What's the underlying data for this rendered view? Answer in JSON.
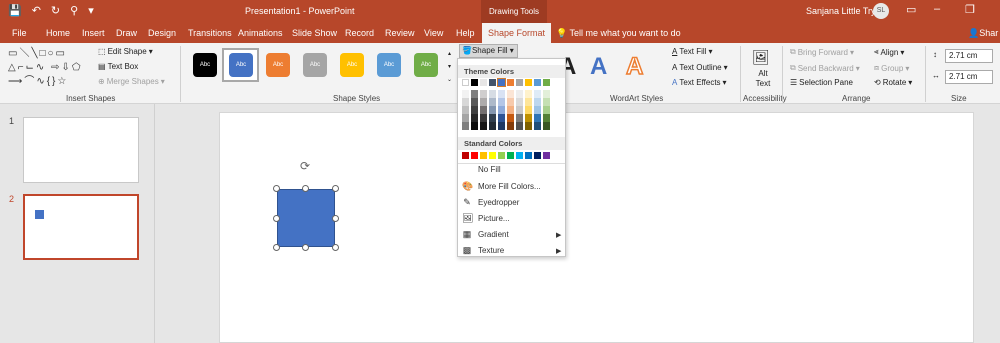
{
  "titlebar": {
    "qat": [
      "💾",
      "↶",
      "↻",
      "⚲",
      "▾"
    ],
    "title": "Presentation1 - PowerPoint",
    "contextual": "Drawing Tools",
    "user": "Sanjana Little Try",
    "avatar": "SL",
    "share": "Shar"
  },
  "tabs": [
    "File",
    "Home",
    "Insert",
    "Draw",
    "Design",
    "Transitions",
    "Animations",
    "Slide Show",
    "Record",
    "Review",
    "View",
    "Help",
    "Shape Format"
  ],
  "tellme": "Tell me what you want to do",
  "ribbon": {
    "insert_shapes": {
      "label": "Insert Shapes",
      "edit_shape": "Edit Shape",
      "text_box": "Text Box",
      "merge_shapes": "Merge Shapes"
    },
    "shape_styles": {
      "label": "Shape Styles",
      "sample": "Abc",
      "colors": [
        "#000000",
        "#4472c4",
        "#ed7d31",
        "#a5a5a5",
        "#ffc000",
        "#5b9bd5",
        "#70ad47"
      ]
    },
    "shape_fill": "Shape Fill",
    "wordart": {
      "label": "WordArt Styles",
      "text_fill": "Text Fill",
      "text_outline": "Text Outline",
      "text_effects": "Text Effects"
    },
    "accessibility": {
      "label": "Accessibility",
      "alt_text": "Alt Text"
    },
    "arrange": {
      "label": "Arrange",
      "bring_forward": "Bring Forward",
      "send_backward": "Send Backward",
      "selection_pane": "Selection Pane",
      "align": "Align",
      "group": "Group",
      "rotate": "Rotate"
    },
    "size": {
      "label": "Size",
      "height": "2.71 cm",
      "width": "2.71 cm"
    }
  },
  "slides": [
    "1",
    "2"
  ],
  "dropdown": {
    "theme_colors_label": "Theme Colors",
    "theme_top_row": [
      "#ffffff",
      "#000000",
      "#e7e6e6",
      "#44546a",
      "#4472c4",
      "#ed7d31",
      "#a5a5a5",
      "#ffc000",
      "#5b9bd5",
      "#70ad47"
    ],
    "theme_shades": [
      [
        "#f2f2f2",
        "#7f7f7f",
        "#d0cece",
        "#d6dce4",
        "#d9e2f3",
        "#fbe5d5",
        "#ededed",
        "#fff2cc",
        "#deebf6",
        "#e2efd9"
      ],
      [
        "#d8d8d8",
        "#595959",
        "#aeabab",
        "#adb9ca",
        "#b4c6e7",
        "#f7caac",
        "#dbdbdb",
        "#fee599",
        "#bdd7ee",
        "#c5e0b3"
      ],
      [
        "#bfbfbf",
        "#3f3f3f",
        "#757070",
        "#8496b0",
        "#8eaadb",
        "#f4b183",
        "#c9c9c9",
        "#ffd965",
        "#9cc3e5",
        "#a8d08d"
      ],
      [
        "#a5a5a5",
        "#262626",
        "#3a3838",
        "#323f4f",
        "#2f5496",
        "#c55a11",
        "#7b7b7b",
        "#bf9000",
        "#2e75b5",
        "#538135"
      ],
      [
        "#7f7f7f",
        "#0c0c0c",
        "#171616",
        "#222a35",
        "#1f3864",
        "#833c0b",
        "#525252",
        "#7f6000",
        "#1e4e79",
        "#375623"
      ]
    ],
    "standard_colors_label": "Standard Colors",
    "standard_colors": [
      "#c00000",
      "#ff0000",
      "#ffc000",
      "#ffff00",
      "#92d050",
      "#00b050",
      "#00b0f0",
      "#0070c0",
      "#002060",
      "#7030a0"
    ],
    "items": [
      "No Fill",
      "More Fill Colors...",
      "Eyedropper",
      "Picture...",
      "Gradient",
      "Texture"
    ]
  }
}
